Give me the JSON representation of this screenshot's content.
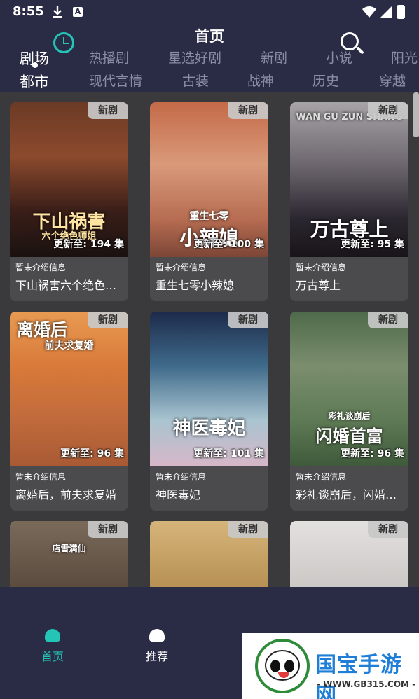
{
  "status_bar": {
    "time": "8:55",
    "icons": [
      "download-icon",
      "a-icon",
      "wifi-icon",
      "signal-icon",
      "battery-icon"
    ]
  },
  "header": {
    "title": "首页",
    "left_icon": "clock-icon",
    "right_icon": "search-icon",
    "accent_color": "#24c4b6"
  },
  "tabs_row1": [
    "剧场",
    "热播剧",
    "星选好剧",
    "新剧",
    "小说",
    "阳光"
  ],
  "tabs_row2": [
    "都市",
    "现代言情",
    "古装",
    "战神",
    "历史",
    "穿越"
  ],
  "cards": [
    {
      "badge": "新剧",
      "episodes": "更新至: 194 集",
      "intro": "暂未介绍信息",
      "name": "下山祸害六个绝色师…",
      "poster_text": "下山祸害",
      "poster_sub": "六个绝色师姐"
    },
    {
      "badge": "新剧",
      "episodes": "更新至: 100 集",
      "intro": "暂未介绍信息",
      "name": "重生七零小辣媳",
      "poster_text": "小辣媳",
      "poster_sub": "重生七零"
    },
    {
      "badge": "新剧",
      "episodes": "更新至: 95 集",
      "intro": "暂未介绍信息",
      "name": "万古尊上",
      "poster_text": "万古尊上",
      "poster_sub": "WAN GU ZUN SHANG"
    },
    {
      "badge": "新剧",
      "episodes": "更新至: 96 集",
      "intro": "暂未介绍信息",
      "name": "离婚后，前夫求复婚",
      "poster_text": "离婚后",
      "poster_sub": "前夫求复婚"
    },
    {
      "badge": "新剧",
      "episodes": "更新至: 101 集",
      "intro": "暂未介绍信息",
      "name": "神医毒妃",
      "poster_text": "神医毒妃",
      "poster_sub": ""
    },
    {
      "badge": "新剧",
      "episodes": "更新至: 96 集",
      "intro": "暂未介绍信息",
      "name": "彩礼谈崩后，闪婚神…",
      "poster_text": "闪婚首富",
      "poster_sub": "彩礼谈崩后"
    },
    {
      "badge": "新剧",
      "episodes": "",
      "intro": "",
      "name": "",
      "poster_text": "",
      "poster_sub": "店雪满仙"
    },
    {
      "badge": "新剧",
      "episodes": "",
      "intro": "",
      "name": "",
      "poster_text": "",
      "poster_sub": ""
    },
    {
      "badge": "新剧",
      "episodes": "",
      "intro": "",
      "name": "",
      "poster_text": "",
      "poster_sub": ""
    }
  ],
  "bottom_nav": [
    {
      "label": "首页",
      "icon": "home-ghost-icon",
      "active": true
    },
    {
      "label": "推荐",
      "icon": "recommend-ghost-icon",
      "active": false
    }
  ],
  "watermark": {
    "title": "国宝手游网",
    "url": "- WWW.GB315.COM -"
  }
}
